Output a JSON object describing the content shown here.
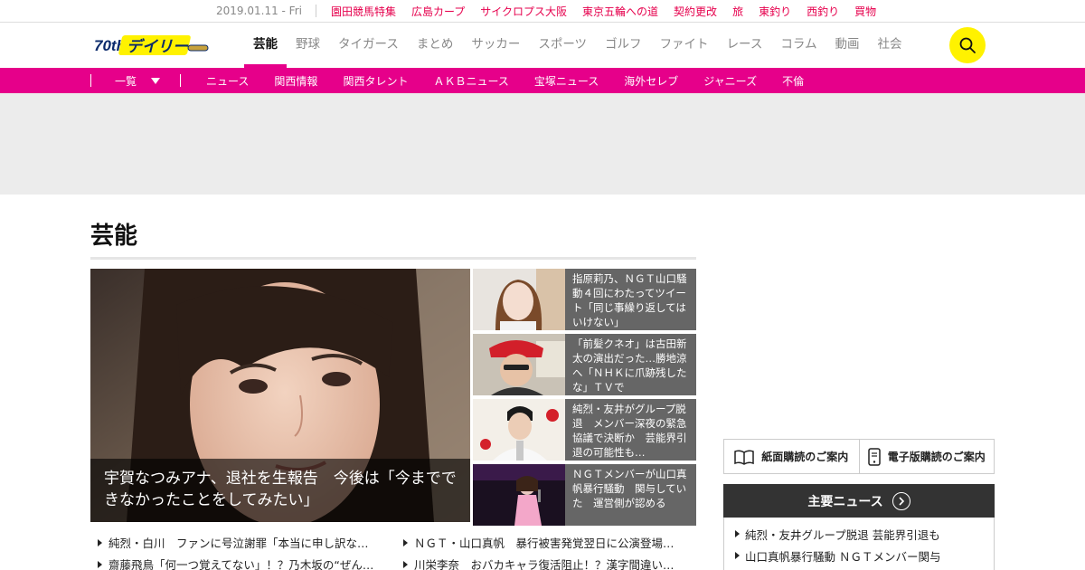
{
  "topbar": {
    "date": "2019.01.11 - Fri",
    "links": [
      "園田競馬特集",
      "広島カープ",
      "サイクロプス大阪",
      "東京五輪への道",
      "契約更改",
      "旅",
      "東釣り",
      "西釣り",
      "買物"
    ]
  },
  "header": {
    "logo_text": "デイリー",
    "logo_badge": "70th",
    "nav": [
      "芸能",
      "野球",
      "タイガース",
      "まとめ",
      "サッカー",
      "スポーツ",
      "ゴルフ",
      "ファイト",
      "レース",
      "コラム",
      "動画",
      "社会"
    ],
    "active_nav": "芸能"
  },
  "subnav": {
    "toggle_label": "一覧",
    "items": [
      "ニュース",
      "関西情報",
      "関西タレント",
      "ＡＫＢニュース",
      "宝塚ニュース",
      "海外セレブ",
      "ジャニーズ",
      "不倫"
    ]
  },
  "section": {
    "title": "芸能"
  },
  "main_story": {
    "caption": "宇賀なつみアナ、退社を生報告　今後は「今までできなかったことをしてみたい」"
  },
  "side_stories": [
    {
      "text": "指原莉乃、ＮＧＴ山口騒動４回にわたってツイート「同じ事繰り返してはいけない」"
    },
    {
      "text": "「前髪クネオ」は古田新太の演出だった…勝地涼へ「ＮＨＫに爪跡残したな」ＴＶで"
    },
    {
      "text": "純烈・友井がグループ脱退　メンバー深夜の緊急協議で決断か　芸能界引退の可能性も…"
    },
    {
      "text": "ＮＧＴメンバーが山口真帆暴行騒動　関与していた　運営側が認める"
    }
  ],
  "headlines": [
    "純烈・白川　ファンに号泣謝罪「本当に申し訳な…",
    "ＮＧＴ・山口真帆　暴行被害発覚翌日に公演登場…",
    "齋藤飛鳥「何一つ覚えてない」！？乃木坂の“ぜん…",
    "川栄李奈　おバカキャラ復活阻止！？漢字間違い…"
  ],
  "subscribe": {
    "paper": "紙面購読のご案内",
    "digital": "電子版購読のご案内"
  },
  "major_news": {
    "title": "主要ニュース",
    "items": [
      "純烈・友井グループ脱退 芸能界引退も",
      "山口真帆暴行騒動 ＮＧＴメンバー関与"
    ]
  },
  "colors": {
    "brand_pink": "#e6008a",
    "top_link_red": "#e6004d",
    "search_yellow": "#fff200",
    "dark_header": "#333333"
  }
}
